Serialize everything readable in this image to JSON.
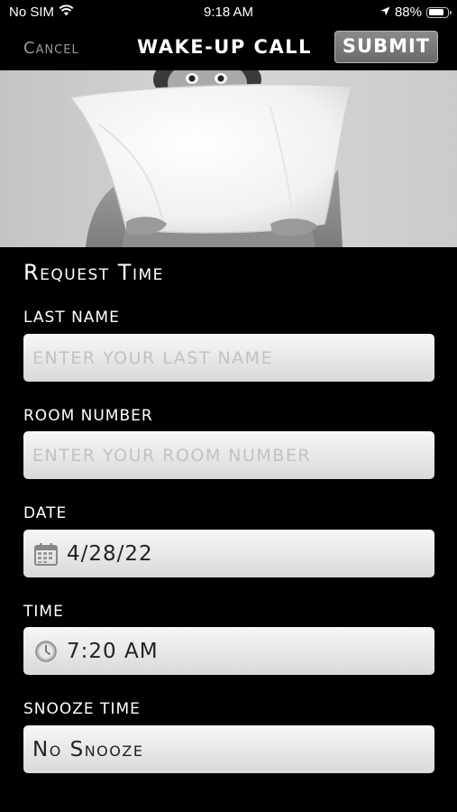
{
  "status_bar": {
    "carrier": "No SIM",
    "time": "9:18 AM",
    "battery": "88%",
    "battery_level": 0.88,
    "icons": [
      "wifi-icon",
      "location-arrow-icon",
      "battery-icon"
    ]
  },
  "nav": {
    "cancel_label": "Cancel",
    "title": "WAKE-UP CALL",
    "submit_label": "SUBMIT"
  },
  "form": {
    "section_title": "Request Time",
    "last_name": {
      "label": "LAST NAME",
      "placeholder": "ENTER YOUR LAST NAME",
      "value": ""
    },
    "room_number": {
      "label": "ROOM NUMBER",
      "placeholder": "ENTER YOUR ROOM NUMBER",
      "value": ""
    },
    "date": {
      "label": "DATE",
      "value": "4/28/22",
      "icon": "calendar-icon"
    },
    "time": {
      "label": "TIME",
      "value": "7:20 AM",
      "icon": "clock-icon"
    },
    "snooze": {
      "label": "SNOOZE TIME",
      "value": "No Snooze"
    }
  },
  "colors": {
    "background": "#000000",
    "submit_button": "#7a7a7a",
    "cancel_text": "#9a9a9a",
    "field_background": "#eeeeee",
    "placeholder_text": "#c2c2c2"
  }
}
